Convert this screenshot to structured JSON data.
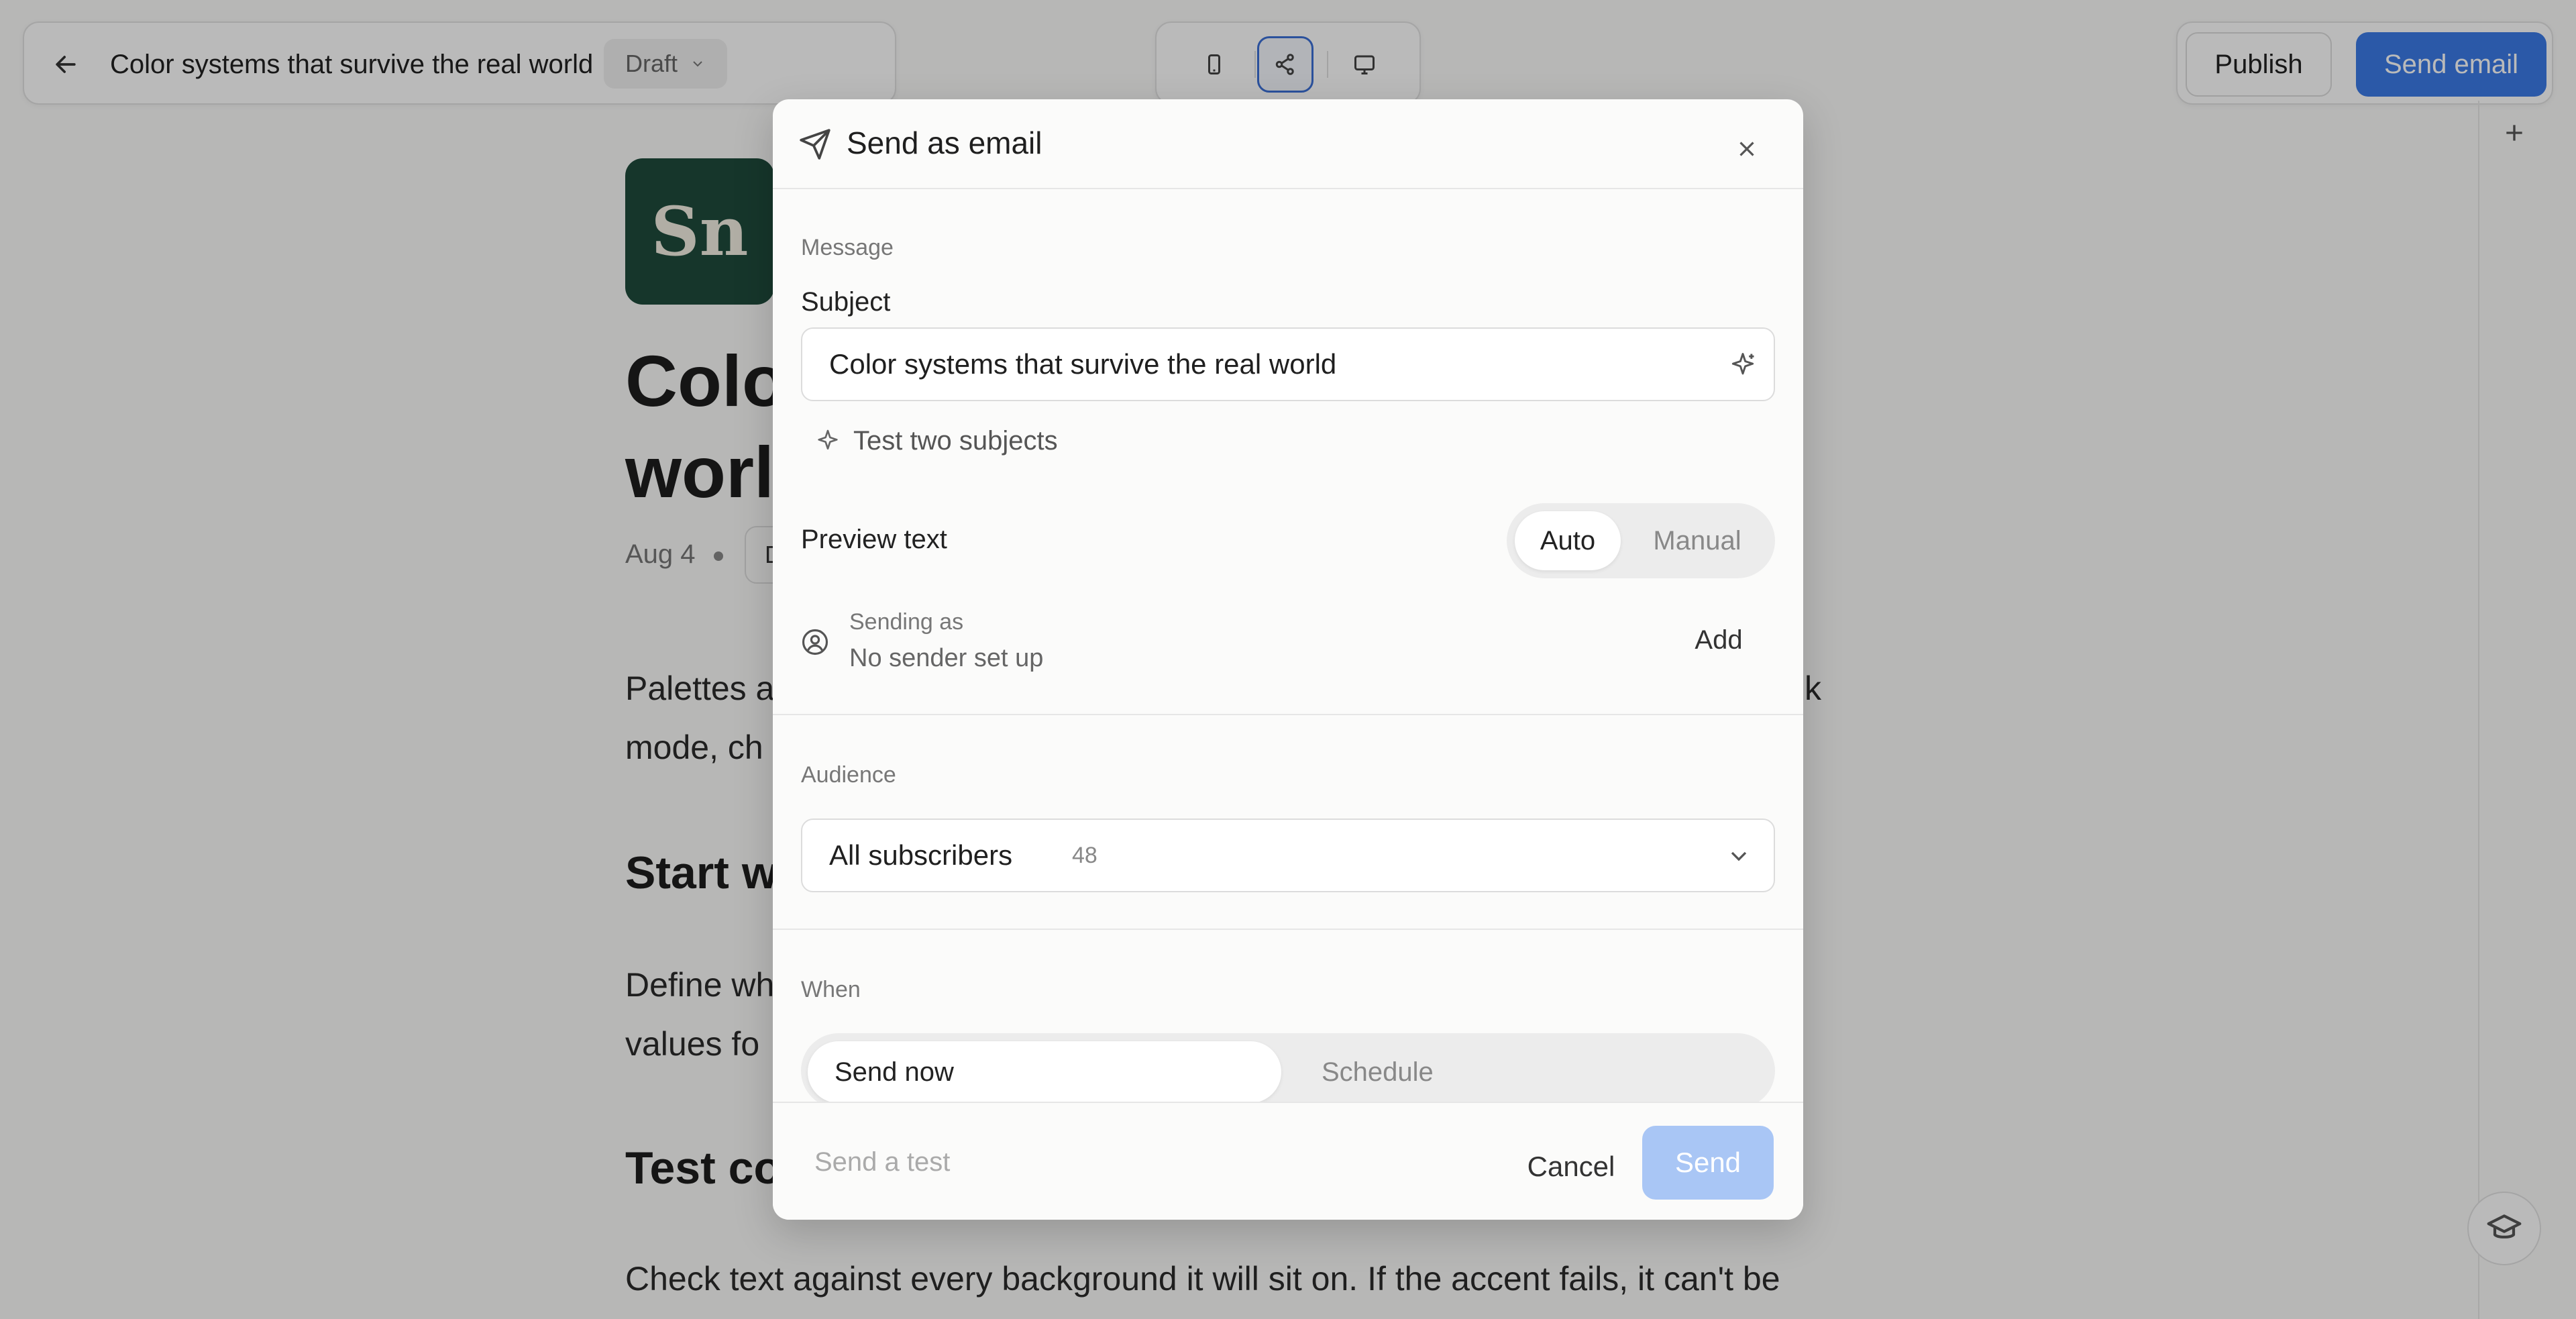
{
  "header": {
    "doc_title": "Color systems that survive the real world",
    "status": "Draft",
    "publish_label": "Publish",
    "send_email_label": "Send email"
  },
  "article": {
    "logo_text": "Sn",
    "title_line1": "Color",
    "title_line2": "world",
    "date": "Aug 4",
    "pill_text": "D",
    "para1_line1": "Palettes a",
    "para1_line1_end": "k",
    "para1_line2": "mode, ch",
    "h2_1": "Start w",
    "para2_line1": "Define wh",
    "para2_line2": "values fo",
    "h2_2": "Test co",
    "para3_line1": "Check text against every background it will sit on. If the accent fails, it can't be"
  },
  "modal": {
    "title": "Send as email",
    "message_section": "Message",
    "subject_label": "Subject",
    "subject_value": "Color systems that survive the real world",
    "test_two_label": "Test two subjects",
    "preview_text_label": "Preview text",
    "preview_options": [
      "Auto",
      "Manual"
    ],
    "preview_selected": "Auto",
    "sending_as_label": "Sending as",
    "sender_value": "No sender set up",
    "add_label": "Add",
    "audience_section": "Audience",
    "audience_value": "All subscribers",
    "audience_count": "48",
    "when_section": "When",
    "when_options": [
      "Send now",
      "Schedule"
    ],
    "when_selected": "Send now",
    "send_test_label": "Send a test",
    "cancel_label": "Cancel",
    "send_label": "Send"
  },
  "colors": {
    "accent": "#3b7be6",
    "send_disabled": "#a9c6f5",
    "logo_bg": "#1f4a3c"
  }
}
